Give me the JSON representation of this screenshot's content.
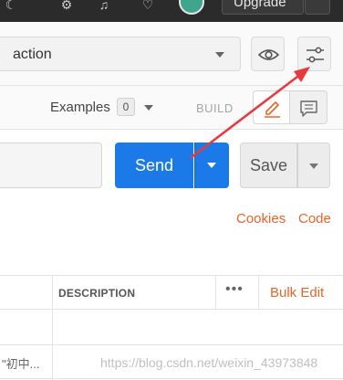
{
  "topbar": {
    "upgrade_label": "Upgrade"
  },
  "environment": {
    "selected": "action"
  },
  "examples": {
    "label": "Examples",
    "count": "0",
    "build_label": "BUILD"
  },
  "request": {
    "send_label": "Send",
    "save_label": "Save"
  },
  "links": {
    "cookies": "Cookies",
    "code": "Code"
  },
  "table": {
    "headers": {
      "description": "DESCRIPTION",
      "more": "•••",
      "bulk_edit": "Bulk Edit"
    },
    "rows": [
      {
        "value": "\"初中..."
      }
    ]
  },
  "watermark": "https://blog.csdn.net/weixin_43973848",
  "colors": {
    "send": "#1b7ae8",
    "accent_orange": "#e8652a",
    "annotation_arrow": "#e8393f"
  }
}
